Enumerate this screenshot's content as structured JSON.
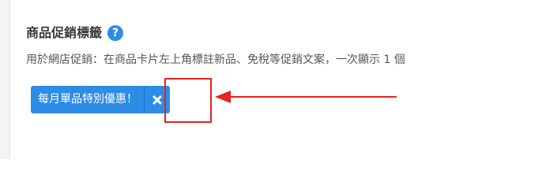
{
  "section": {
    "title": "商品促銷標籤",
    "help_icon": "question-circle-icon",
    "description": "用於網店促銷：在商品卡片左上角標註新品、免稅等促銷文案，一次顯示 1 個"
  },
  "tag": {
    "label": "每月單品特別優惠！",
    "remove_icon": "close-x-icon"
  },
  "colors": {
    "accent": "#2d8ce6",
    "annotation": "#e8221c",
    "text_primary": "#3a3a3a",
    "text_secondary": "#555555"
  }
}
